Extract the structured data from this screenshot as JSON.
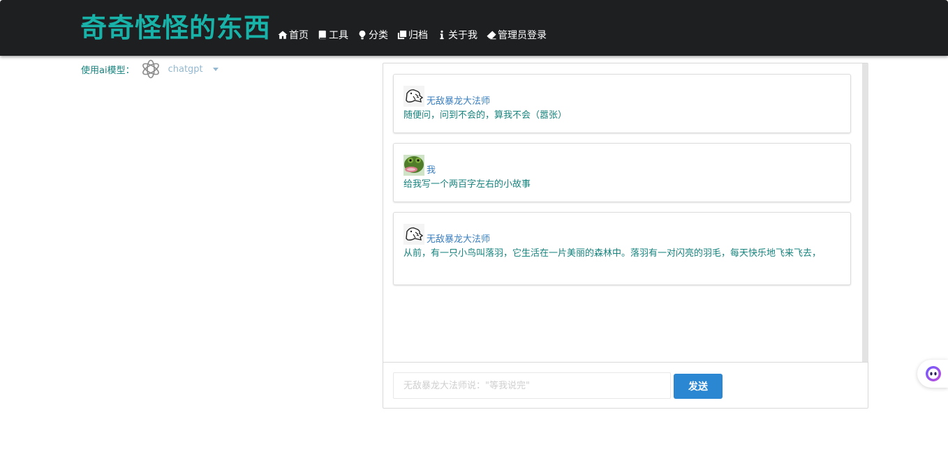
{
  "site": {
    "title": "奇奇怪怪的东西"
  },
  "nav": [
    {
      "label": "首页",
      "icon": "home-icon"
    },
    {
      "label": "工具",
      "icon": "book-icon"
    },
    {
      "label": "分类",
      "icon": "lightbulb-icon"
    },
    {
      "label": "归档",
      "icon": "copy-icon"
    },
    {
      "label": "关于我",
      "icon": "info-icon"
    },
    {
      "label": "管理员登录",
      "icon": "eraser-icon"
    }
  ],
  "model": {
    "label": "使用ai模型：",
    "selected": "chatgpt",
    "icon": "openai-logo"
  },
  "messages": [
    {
      "name": "无敌暴龙大法师",
      "text": "随便问，问到不会的，算我不会（嚣张）",
      "avatar": "sketch-avatar"
    },
    {
      "name": "我",
      "text": "给我写一个两百字左右的小故事",
      "avatar": "frog-avatar"
    },
    {
      "name": "无敌暴龙大法师",
      "text": "从前，有一只小鸟叫落羽，它生活在一片美丽的森林中。落羽有一对闪亮的羽毛，每天快乐地飞来飞去，",
      "avatar": "sketch-avatar"
    }
  ],
  "input": {
    "placeholder": "无敌暴龙大法师说：\"等我说完\"",
    "value": ""
  },
  "send": {
    "label": "发送"
  },
  "colors": {
    "header_bg": "#1e1f21",
    "title": "#19b2a8",
    "text_teal": "#17837d",
    "name_blue": "#3a7fc1",
    "send_button": "#2b87d1"
  }
}
